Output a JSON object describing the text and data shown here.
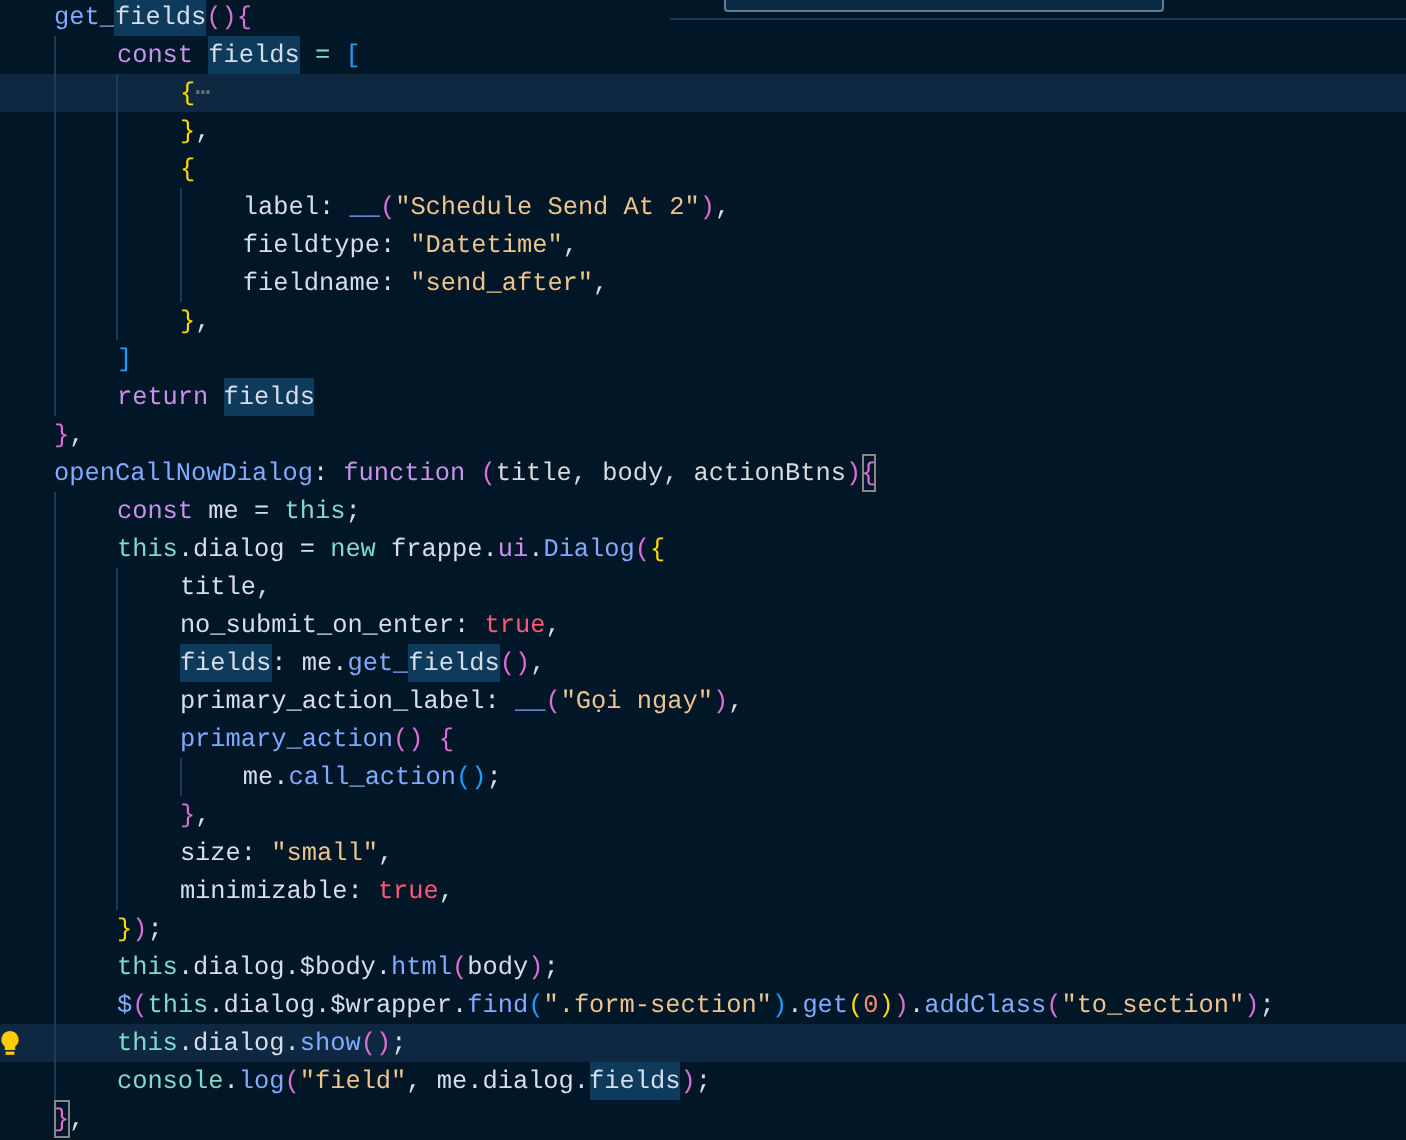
{
  "editor": {
    "lines": [
      {
        "current": false,
        "lightbulb": false,
        "tokens": [
          {
            "text": "get_",
            "kind": "fn"
          },
          {
            "text": "fields",
            "kind": "ref"
          },
          {
            "text": "()",
            "kind": "b2"
          },
          {
            "text": "{",
            "kind": "b2"
          }
        ]
      },
      {
        "current": false,
        "lightbulb": false,
        "tokens": [
          {
            "text": "    const ",
            "kind": "kw"
          },
          {
            "text": "fields",
            "kind": "ref"
          },
          {
            "text": " = ",
            "kind": "op"
          },
          {
            "text": "[",
            "kind": "b3"
          }
        ]
      },
      {
        "current": true,
        "lightbulb": false,
        "tokens": [
          {
            "text": "        {",
            "kind": "b1"
          },
          {
            "text": "⋯",
            "kind": "fold"
          }
        ]
      },
      {
        "current": false,
        "lightbulb": false,
        "tokens": [
          {
            "text": "        }",
            "kind": "b1"
          },
          {
            "text": ",",
            "kind": "punc"
          }
        ]
      },
      {
        "current": false,
        "lightbulb": false,
        "tokens": [
          {
            "text": "        {",
            "kind": "b1"
          }
        ]
      },
      {
        "current": false,
        "lightbulb": false,
        "tokens": [
          {
            "text": "            label",
            "kind": "prop"
          },
          {
            "text": ": ",
            "kind": "punc"
          },
          {
            "text": "__",
            "kind": "fn"
          },
          {
            "text": "(",
            "kind": "b2"
          },
          {
            "text": "\"Schedule Send At 2\"",
            "kind": "str"
          },
          {
            "text": ")",
            "kind": "b2"
          },
          {
            "text": ",",
            "kind": "punc"
          }
        ]
      },
      {
        "current": false,
        "lightbulb": false,
        "tokens": [
          {
            "text": "            fieldtype",
            "kind": "prop"
          },
          {
            "text": ": ",
            "kind": "punc"
          },
          {
            "text": "\"Datetime\"",
            "kind": "str"
          },
          {
            "text": ",",
            "kind": "punc"
          }
        ]
      },
      {
        "current": false,
        "lightbulb": false,
        "tokens": [
          {
            "text": "            fieldname",
            "kind": "prop"
          },
          {
            "text": ": ",
            "kind": "punc"
          },
          {
            "text": "\"send_after\"",
            "kind": "str"
          },
          {
            "text": ",",
            "kind": "punc"
          }
        ]
      },
      {
        "current": false,
        "lightbulb": false,
        "tokens": [
          {
            "text": "        }",
            "kind": "b1"
          },
          {
            "text": ",",
            "kind": "punc"
          }
        ]
      },
      {
        "current": false,
        "lightbulb": false,
        "tokens": [
          {
            "text": "    ]",
            "kind": "b3"
          }
        ]
      },
      {
        "current": false,
        "lightbulb": false,
        "tokens": [
          {
            "text": "    return ",
            "kind": "kw"
          },
          {
            "text": "fields",
            "kind": "ref"
          }
        ]
      },
      {
        "current": false,
        "lightbulb": false,
        "tokens": [
          {
            "text": "}",
            "kind": "b2"
          },
          {
            "text": ",",
            "kind": "punc"
          }
        ]
      },
      {
        "current": false,
        "lightbulb": false,
        "tokens": [
          {
            "text": "openCallNowDialog",
            "kind": "fn"
          },
          {
            "text": ": ",
            "kind": "punc"
          },
          {
            "text": "function ",
            "kind": "kw"
          },
          {
            "text": "(",
            "kind": "b2"
          },
          {
            "text": "title, body, actionBtns",
            "kind": "param"
          },
          {
            "text": ")",
            "kind": "b2"
          },
          {
            "text": "{",
            "kind": "match"
          }
        ]
      },
      {
        "current": false,
        "lightbulb": false,
        "tokens": [
          {
            "text": "    const",
            "kind": "kw"
          },
          {
            "text": " me = ",
            "kind": "plain"
          },
          {
            "text": "this",
            "kind": "this"
          },
          {
            "text": ";",
            "kind": "punc"
          }
        ]
      },
      {
        "current": false,
        "lightbulb": false,
        "tokens": [
          {
            "text": "    this",
            "kind": "this"
          },
          {
            "text": ".dialog = ",
            "kind": "plain"
          },
          {
            "text": "new",
            "kind": "this"
          },
          {
            "text": " frappe.",
            "kind": "plain"
          },
          {
            "text": "ui",
            "kind": "kw"
          },
          {
            "text": ".",
            "kind": "plain"
          },
          {
            "text": "Dialog",
            "kind": "fn"
          },
          {
            "text": "(",
            "kind": "b2"
          },
          {
            "text": "{",
            "kind": "b1"
          }
        ]
      },
      {
        "current": false,
        "lightbulb": false,
        "tokens": [
          {
            "text": "        title",
            "kind": "prop"
          },
          {
            "text": ",",
            "kind": "punc"
          }
        ]
      },
      {
        "current": false,
        "lightbulb": false,
        "tokens": [
          {
            "text": "        no_submit_on_enter",
            "kind": "prop"
          },
          {
            "text": ": ",
            "kind": "punc"
          },
          {
            "text": "true",
            "kind": "bool"
          },
          {
            "text": ",",
            "kind": "punc"
          }
        ]
      },
      {
        "current": false,
        "lightbulb": false,
        "tokens": [
          {
            "text": "        fields",
            "kind": "ref"
          },
          {
            "text": ": me.",
            "kind": "punc"
          },
          {
            "text": "get_",
            "kind": "fn"
          },
          {
            "text": "fields",
            "kind": "ref"
          },
          {
            "text": "()",
            "kind": "b2"
          },
          {
            "text": ",",
            "kind": "punc"
          }
        ]
      },
      {
        "current": false,
        "lightbulb": false,
        "tokens": [
          {
            "text": "        primary_action_label",
            "kind": "prop"
          },
          {
            "text": ": ",
            "kind": "punc"
          },
          {
            "text": "__",
            "kind": "fn"
          },
          {
            "text": "(",
            "kind": "b2"
          },
          {
            "text": "\"Gọi ngay\"",
            "kind": "str"
          },
          {
            "text": ")",
            "kind": "b2"
          },
          {
            "text": ",",
            "kind": "punc"
          }
        ]
      },
      {
        "current": false,
        "lightbulb": false,
        "tokens": [
          {
            "text": "        primary_action",
            "kind": "fn"
          },
          {
            "text": "() ",
            "kind": "b2"
          },
          {
            "text": "{",
            "kind": "b2"
          }
        ]
      },
      {
        "current": false,
        "lightbulb": false,
        "tokens": [
          {
            "text": "            me.",
            "kind": "plain"
          },
          {
            "text": "call_action",
            "kind": "fn"
          },
          {
            "text": "()",
            "kind": "b3"
          },
          {
            "text": ";",
            "kind": "punc"
          }
        ]
      },
      {
        "current": false,
        "lightbulb": false,
        "tokens": [
          {
            "text": "        }",
            "kind": "b2"
          },
          {
            "text": ",",
            "kind": "punc"
          }
        ]
      },
      {
        "current": false,
        "lightbulb": false,
        "tokens": [
          {
            "text": "        size",
            "kind": "prop"
          },
          {
            "text": ": ",
            "kind": "punc"
          },
          {
            "text": "\"small\"",
            "kind": "str"
          },
          {
            "text": ",",
            "kind": "punc"
          }
        ]
      },
      {
        "current": false,
        "lightbulb": false,
        "tokens": [
          {
            "text": "        minimizable",
            "kind": "prop"
          },
          {
            "text": ": ",
            "kind": "punc"
          },
          {
            "text": "true",
            "kind": "bool"
          },
          {
            "text": ",",
            "kind": "punc"
          }
        ]
      },
      {
        "current": false,
        "lightbulb": false,
        "tokens": [
          {
            "text": "    }",
            "kind": "b1"
          },
          {
            "text": ")",
            "kind": "b2"
          },
          {
            "text": ";",
            "kind": "punc"
          }
        ]
      },
      {
        "current": false,
        "lightbulb": false,
        "tokens": [
          {
            "text": "    this",
            "kind": "this"
          },
          {
            "text": ".dialog.$body.",
            "kind": "plain"
          },
          {
            "text": "html",
            "kind": "fn"
          },
          {
            "text": "(",
            "kind": "b2"
          },
          {
            "text": "body",
            "kind": "plain"
          },
          {
            "text": ")",
            "kind": "b2"
          },
          {
            "text": ";",
            "kind": "punc"
          }
        ]
      },
      {
        "current": false,
        "lightbulb": false,
        "tokens": [
          {
            "text": "    $",
            "kind": "fn"
          },
          {
            "text": "(",
            "kind": "b2"
          },
          {
            "text": "this",
            "kind": "this"
          },
          {
            "text": ".dialog.$wrapper.",
            "kind": "plain"
          },
          {
            "text": "find",
            "kind": "fn"
          },
          {
            "text": "(",
            "kind": "b3"
          },
          {
            "text": "\".form-section\"",
            "kind": "str"
          },
          {
            "text": ")",
            "kind": "b3"
          },
          {
            "text": ".",
            "kind": "plain"
          },
          {
            "text": "get",
            "kind": "fn"
          },
          {
            "text": "(",
            "kind": "b1"
          },
          {
            "text": "0",
            "kind": "num"
          },
          {
            "text": ")",
            "kind": "b1"
          },
          {
            "text": ")",
            "kind": "b2"
          },
          {
            "text": ".",
            "kind": "plain"
          },
          {
            "text": "addClass",
            "kind": "fn"
          },
          {
            "text": "(",
            "kind": "b2"
          },
          {
            "text": "\"to_section\"",
            "kind": "str"
          },
          {
            "text": ")",
            "kind": "b2"
          },
          {
            "text": ";",
            "kind": "punc"
          }
        ]
      },
      {
        "current": true,
        "lightbulb": true,
        "tokens": [
          {
            "text": "    this",
            "kind": "this"
          },
          {
            "text": ".dialog.",
            "kind": "plain"
          },
          {
            "text": "show",
            "kind": "fn"
          },
          {
            "text": "()",
            "kind": "b2"
          },
          {
            "text": ";",
            "kind": "punc"
          }
        ]
      },
      {
        "current": false,
        "lightbulb": false,
        "tokens": [
          {
            "text": "    console",
            "kind": "this"
          },
          {
            "text": ".",
            "kind": "plain"
          },
          {
            "text": "log",
            "kind": "fn"
          },
          {
            "text": "(",
            "kind": "b2"
          },
          {
            "text": "\"field\"",
            "kind": "str"
          },
          {
            "text": ", me.dialog.",
            "kind": "plain"
          },
          {
            "text": "fields",
            "kind": "ref"
          },
          {
            "text": ")",
            "kind": "b2"
          },
          {
            "text": ";",
            "kind": "punc"
          }
        ]
      },
      {
        "current": false,
        "lightbulb": false,
        "tokens": [
          {
            "text": "}",
            "kind": "match"
          },
          {
            "text": ",",
            "kind": "punc"
          }
        ]
      }
    ]
  }
}
